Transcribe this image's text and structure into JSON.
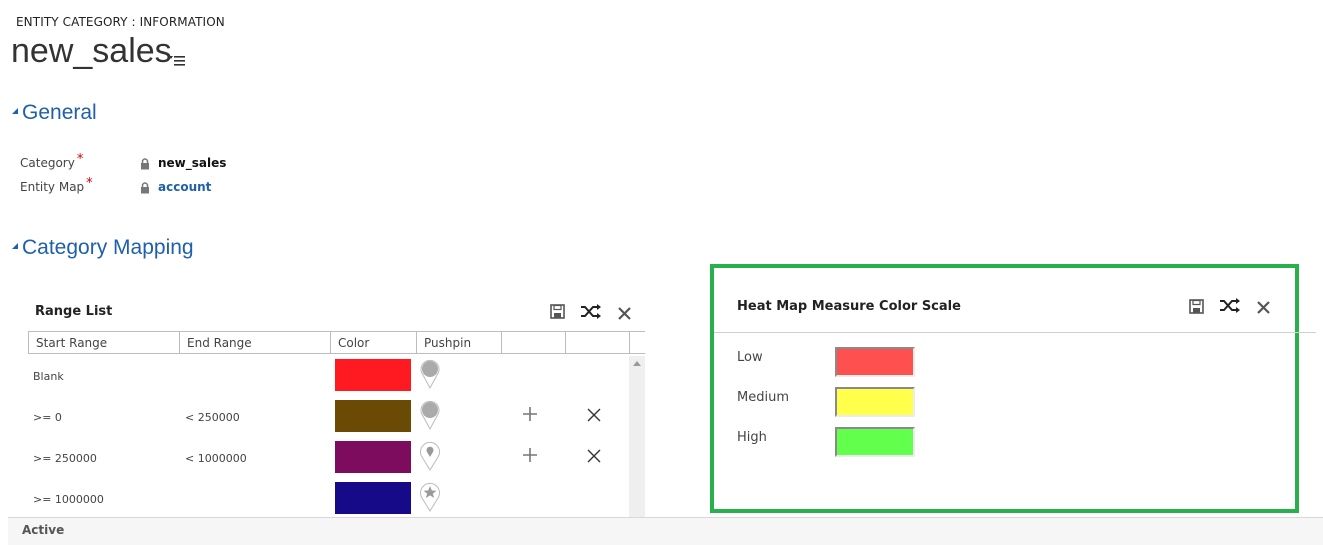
{
  "header": {
    "entity_category": "ENTITY CATEGORY : INFORMATION",
    "title": "new_sales",
    "menu_icon": "list-menu-icon"
  },
  "general": {
    "heading": "General",
    "fields": [
      {
        "label": "Category",
        "required": "*",
        "value": "new_sales",
        "locked": true,
        "link": false
      },
      {
        "label": "Entity Map",
        "required": "*",
        "value": "account",
        "locked": true,
        "link": true
      }
    ]
  },
  "category_mapping": {
    "heading": "Category Mapping"
  },
  "range_list": {
    "title": "Range List",
    "toolbar": {
      "save_icon": "save-icon",
      "shuffle_icon": "shuffle-icon",
      "close_icon": "close-icon"
    },
    "columns": [
      "Start Range",
      "End Range",
      "Color",
      "Pushpin",
      "",
      ""
    ],
    "rows": [
      {
        "start": "Blank",
        "end": "",
        "color": "#ff1a22",
        "pushpin": "pushpin-filled-icon",
        "add": false,
        "remove": false
      },
      {
        "start": ">= 0",
        "end": "< 250000",
        "color": "#6b4a05",
        "pushpin": "pushpin-filled-icon",
        "add": true,
        "remove": true
      },
      {
        "start": ">= 250000",
        "end": "< 1000000",
        "color": "#7d0b5e",
        "pushpin": "pushpin-dot-icon",
        "add": true,
        "remove": true
      },
      {
        "start": ">= 1000000",
        "end": "",
        "color": "#170a88",
        "pushpin": "pushpin-star-icon",
        "add": false,
        "remove": false
      }
    ]
  },
  "heat_map": {
    "title": "Heat Map Measure Color Scale",
    "highlight_color": "#27b04c",
    "levels": [
      {
        "label": "Low",
        "color": "#ff5050"
      },
      {
        "label": "Medium",
        "color": "#ffff4c"
      },
      {
        "label": "High",
        "color": "#62ff4c"
      }
    ]
  },
  "status": {
    "text": "Active"
  }
}
